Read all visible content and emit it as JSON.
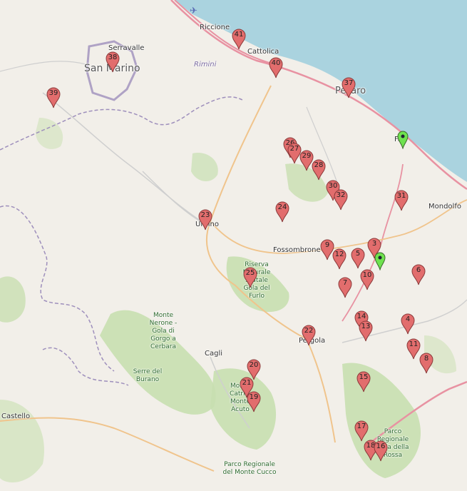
{
  "map": {
    "colors": {
      "sea": "#aad3df",
      "land": "#f2efe9",
      "forest": "#c8dfb0",
      "highway": "#e892a2",
      "border": "#9e8fbc",
      "marker_red": "#e26d6d",
      "marker_green": "#6fe24f"
    },
    "places": {
      "riccione": "Riccione",
      "cattolica": "Cattolica",
      "rimini": "Rimini",
      "serravalle": "Serravalle",
      "san_marino": "San Marino",
      "pesaro": "Pesaro",
      "fano": "Fa",
      "mondolfo": "Mondolfo",
      "urbino": "Urbino",
      "fossombrone": "Fossombrone",
      "pergola": "Pergola",
      "cagli": "Cagli",
      "castello": "Castello",
      "furlo": "Riserva Naturale Statale Gola del Furlo",
      "monte_nerone": "Monte Nerone - Gola di Gorgo a Cerbara",
      "serre_burano": "Serre del Burano",
      "monte_catria": "Monte Catria, Monte Acuto",
      "gola_rossa": "Parco Regionale Gola della Rossa",
      "monte_cucco": "Parco Regionale del Monte Cucco"
    },
    "markers": [
      {
        "label": "41"
      },
      {
        "label": "38"
      },
      {
        "label": "40"
      },
      {
        "label": "37"
      },
      {
        "label": "39"
      },
      {
        "label": "26"
      },
      {
        "label": "27"
      },
      {
        "label": "29"
      },
      {
        "label": "28"
      },
      {
        "label": "30"
      },
      {
        "label": "32"
      },
      {
        "label": "31"
      },
      {
        "label": "24"
      },
      {
        "label": "23"
      },
      {
        "label": "9"
      },
      {
        "label": "3"
      },
      {
        "label": "12"
      },
      {
        "label": "5"
      },
      {
        "label": "25"
      },
      {
        "label": "10"
      },
      {
        "label": "6"
      },
      {
        "label": "7"
      },
      {
        "label": "14"
      },
      {
        "label": "13"
      },
      {
        "label": "4"
      },
      {
        "label": "22"
      },
      {
        "label": "11"
      },
      {
        "label": "8"
      },
      {
        "label": "20"
      },
      {
        "label": "15"
      },
      {
        "label": "21"
      },
      {
        "label": "19"
      },
      {
        "label": "17"
      },
      {
        "label": "18"
      },
      {
        "label": "16"
      }
    ],
    "green_markers": [
      "green-marker-pesaro-coast",
      "green-marker-inland"
    ]
  }
}
